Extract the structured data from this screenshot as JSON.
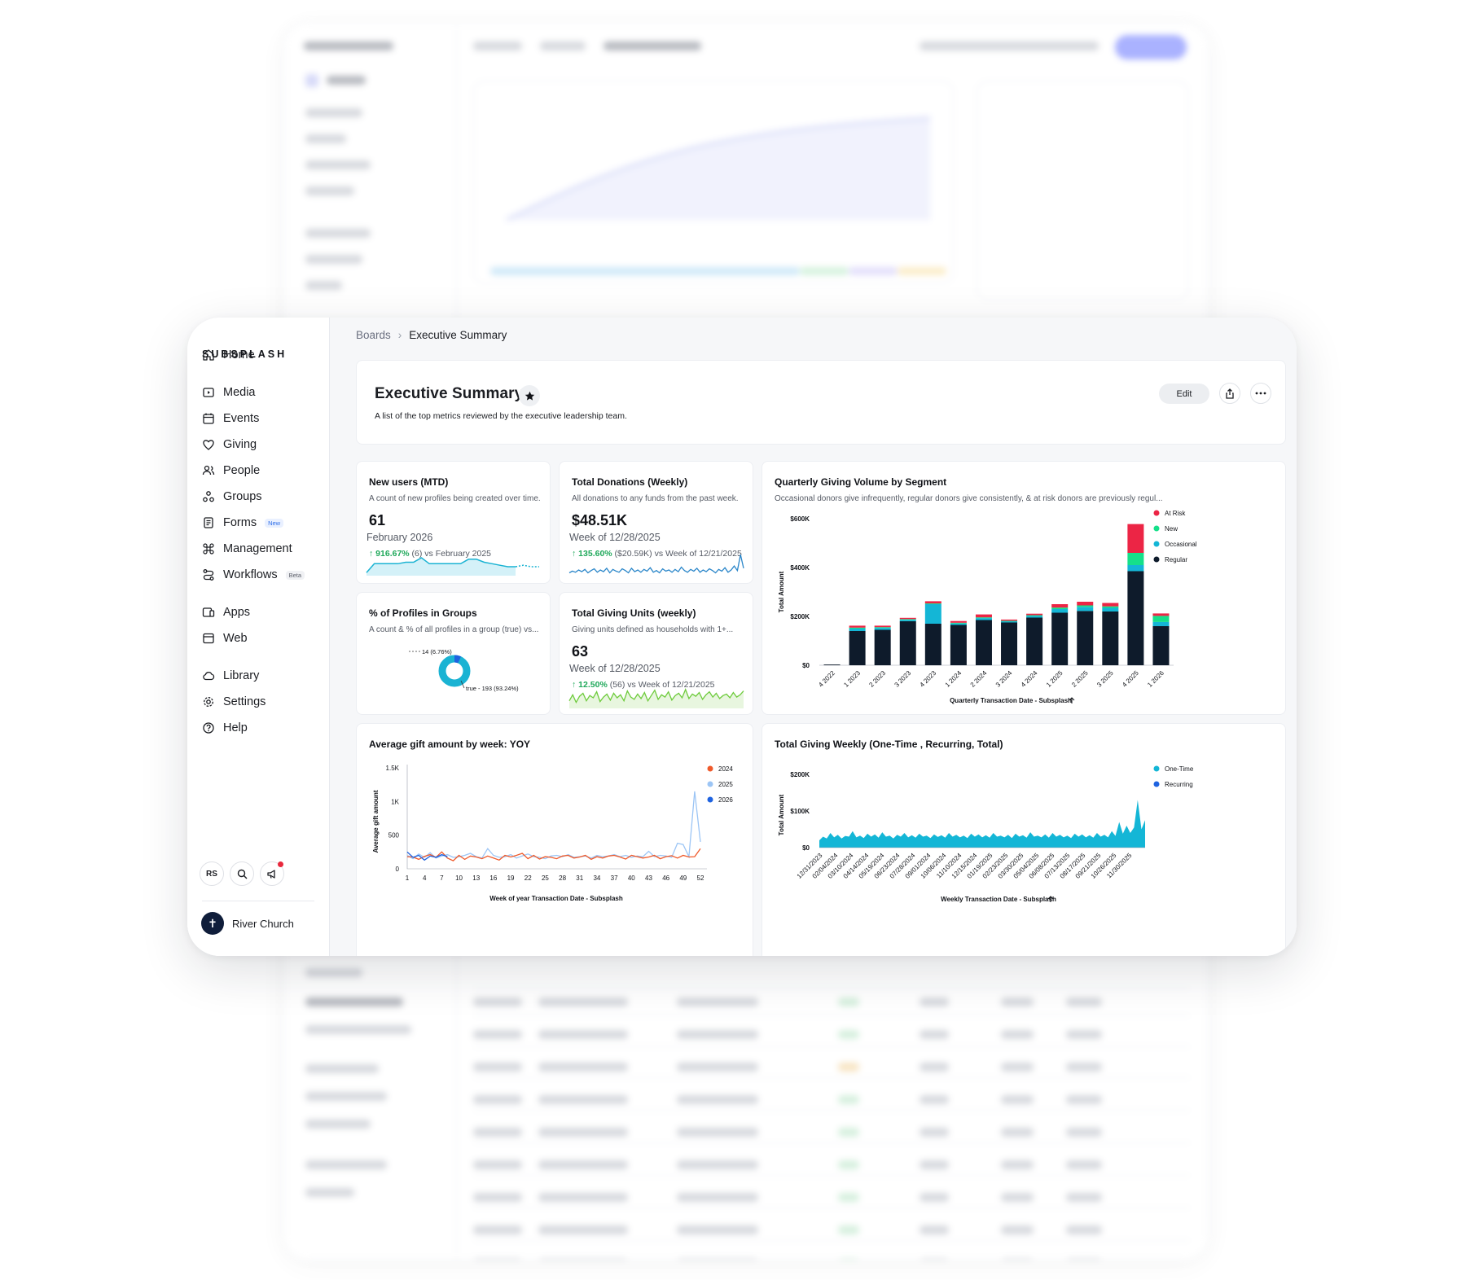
{
  "sidebar": {
    "logo": "SUBSPLASH",
    "items": [
      {
        "label": "Home"
      },
      {
        "label": "Media"
      },
      {
        "label": "Events"
      },
      {
        "label": "Giving"
      },
      {
        "label": "People"
      },
      {
        "label": "Groups"
      },
      {
        "label": "Forms",
        "badge": "New"
      },
      {
        "label": "Management"
      },
      {
        "label": "Workflows",
        "badge": "Beta"
      },
      {
        "label": "Apps"
      },
      {
        "label": "Web"
      },
      {
        "label": "Library"
      },
      {
        "label": "Settings"
      },
      {
        "label": "Help"
      }
    ],
    "user_initials": "RS",
    "org_name": "River Church"
  },
  "breadcrumb": {
    "parent": "Boards",
    "current": "Executive Summary"
  },
  "header": {
    "title": "Executive Summary",
    "description": "A list of the top metrics reviewed by the executive leadership team.",
    "edit_label": "Edit"
  },
  "cards": {
    "new_users": {
      "title": "New users (MTD)",
      "description": "A count of new profiles being created over time.",
      "value": "61",
      "period": "February 2026",
      "change_pct": "916.67%",
      "change_detail": "(6) vs February 2025"
    },
    "donations": {
      "title": "Total Donations (Weekly)",
      "description": "All donations to any funds from the past week.",
      "value": "$48.51K",
      "period": "Week of 12/28/2025",
      "change_pct": "135.60%",
      "change_detail": "($20.59K) vs Week of 12/21/2025"
    },
    "profiles_groups": {
      "title": "% of Profiles in Groups",
      "description": "A count & % of all profiles in a group (true) vs...",
      "label_false": "14 (6.76%)",
      "label_true": "true - 193 (93.24%)"
    },
    "giving_units": {
      "title": "Total Giving Units (weekly)",
      "description": "Giving units defined as households with 1+...",
      "value": "63",
      "period": "Week of 12/28/2025",
      "change_pct": "12.50%",
      "change_detail": "(56) vs Week of 12/21/2025"
    },
    "quarterly": {
      "title": "Quarterly Giving Volume by Segment",
      "description": "Occasional donors give infrequently, regular donors give consistently, & at risk donors are previously regul..."
    },
    "avg_gift": {
      "title": "Average gift amount by week: YOY"
    },
    "giving_weekly": {
      "title": "Total Giving Weekly (One-Time , Recurring, Total)"
    }
  },
  "colors": {
    "teal": "#1ab3d3",
    "teal_fill": "#d4f1f8",
    "regular": "#0e1b2b",
    "occasional": "#14b6d6",
    "new": "#15e08a",
    "at_risk": "#ec2545",
    "y2024": "#ef5a2b",
    "y2025": "#9cc5f5",
    "y2026": "#1f63e0",
    "green": "#6ecb3c",
    "up": "#1fa85a"
  },
  "chart_data": [
    {
      "type": "pie",
      "title": "% of Profiles in Groups",
      "categories": [
        "false",
        "true"
      ],
      "values": [
        14,
        193
      ],
      "labels": [
        "14 (6.76%)",
        "true - 193 (93.24%)"
      ]
    },
    {
      "type": "bar",
      "title": "Quarterly Giving Volume by Segment",
      "xlabel": "Quarterly Transaction Date - Subsplash",
      "ylabel": "Total Amount",
      "ylim": [
        0,
        600000
      ],
      "yticks": [
        "$0",
        "$200K",
        "$400K",
        "$600K"
      ],
      "legend_position": "top-right",
      "categories": [
        "4 2022",
        "1 2023",
        "2 2023",
        "3 2023",
        "4 2023",
        "1 2024",
        "2 2024",
        "3 2024",
        "4 2024",
        "1 2025",
        "2 2025",
        "3 2025",
        "4 2025",
        "1 2026"
      ],
      "series": [
        {
          "name": "Regular",
          "values": [
            3000,
            140000,
            145000,
            180000,
            170000,
            165000,
            185000,
            175000,
            195000,
            215000,
            222000,
            220000,
            385000,
            160000
          ]
        },
        {
          "name": "Occasional",
          "values": [
            0,
            10000,
            8000,
            6000,
            80000,
            6000,
            8000,
            5000,
            7000,
            15000,
            17000,
            15000,
            25000,
            17000
          ]
        },
        {
          "name": "New",
          "values": [
            0,
            4000,
            3000,
            3000,
            3000,
            3000,
            3000,
            2000,
            3000,
            6000,
            6000,
            6000,
            50000,
            25000
          ]
        },
        {
          "name": "At Risk",
          "values": [
            0,
            8000,
            6000,
            5000,
            9000,
            7000,
            12000,
            5000,
            6000,
            14000,
            15000,
            14000,
            118000,
            10000
          ]
        }
      ]
    },
    {
      "type": "line",
      "title": "Average gift amount by week: YOY",
      "xlabel": "Week of year Transaction Date - Subsplash",
      "ylabel": "Average gift amount",
      "ylim": [
        0,
        1500
      ],
      "yticks": [
        "0",
        "500",
        "1K",
        "1.5K"
      ],
      "xticks": [
        "1",
        "4",
        "7",
        "10",
        "13",
        "16",
        "19",
        "22",
        "25",
        "28",
        "31",
        "34",
        "37",
        "40",
        "43",
        "46",
        "49",
        "52"
      ],
      "legend_position": "top-right",
      "series": [
        {
          "name": "2024",
          "values": [
            180,
            175,
            140,
            185,
            210,
            170,
            250,
            160,
            120,
            200,
            140,
            190,
            175,
            150,
            190,
            160,
            130,
            200,
            175,
            200,
            230,
            150,
            200,
            145,
            180,
            170,
            150,
            190,
            200,
            160,
            175,
            200,
            140,
            180,
            160,
            190,
            200,
            175,
            145,
            200,
            180,
            160,
            175,
            200,
            150,
            180,
            195,
            160,
            200,
            175,
            180,
            300
          ]
        },
        {
          "name": "2025",
          "values": [
            200,
            150,
            220,
            170,
            240,
            160,
            190,
            210,
            170,
            180,
            200,
            230,
            180,
            160,
            300,
            200,
            170,
            180,
            210,
            160,
            190,
            220,
            180,
            170,
            150,
            190,
            200,
            180,
            210,
            170,
            180,
            190,
            160,
            200,
            180,
            190,
            210,
            180,
            200,
            170,
            190,
            180,
            260,
            180,
            200,
            190,
            170,
            380,
            360,
            180,
            1150,
            400
          ]
        },
        {
          "name": "2026",
          "values": [
            250,
            170,
            200,
            130,
            190,
            170,
            210,
            180
          ]
        }
      ]
    },
    {
      "type": "area",
      "title": "Total Giving Weekly (One-Time , Recurring, Total)",
      "xlabel": "Weekly Transaction Date - Subsplash",
      "ylabel": "Total Amount",
      "ylim": [
        0,
        200000
      ],
      "yticks": [
        "$0",
        "$100K",
        "$200K"
      ],
      "xticks": [
        "12/31/2023",
        "02/04/2024",
        "03/10/2024",
        "04/14/2024",
        "05/19/2024",
        "06/23/2024",
        "07/28/2024",
        "09/01/2024",
        "10/06/2024",
        "11/10/2024",
        "12/15/2024",
        "01/19/2025",
        "02/23/2025",
        "03/30/2025",
        "05/04/2025",
        "06/08/2025",
        "07/13/2025",
        "08/17/2025",
        "09/21/2025",
        "10/26/2025",
        "11/30/2025"
      ],
      "legend_position": "top-right",
      "series": [
        {
          "name": "One-Time",
          "values": [
            20000,
            30000,
            25000,
            40000,
            28000,
            35000,
            25000,
            32000,
            30000,
            45000,
            28000,
            33000,
            26000,
            38000,
            30000,
            36000,
            27000,
            42000,
            30000,
            33000,
            25000,
            35000,
            30000,
            40000,
            28000,
            34000,
            27000,
            38000,
            30000,
            33000,
            26000,
            36000,
            29000,
            34000,
            27000,
            40000,
            30000,
            35000,
            28000,
            33000,
            26000,
            38000,
            30000,
            36000,
            28000,
            34000,
            27000,
            40000,
            30000,
            33000,
            28000,
            35000,
            26000,
            38000,
            30000,
            34000,
            27000,
            42000,
            30000,
            33000,
            28000,
            36000,
            27000,
            40000,
            30000,
            35000,
            28000,
            33000,
            26000,
            38000,
            30000,
            36000,
            28000,
            34000,
            27000,
            40000,
            30000,
            35000,
            28000,
            45000,
            32000,
            70000,
            38000,
            60000,
            40000,
            55000,
            130000,
            50000,
            75000
          ]
        }
      ]
    },
    {
      "type": "area",
      "title": "New users (MTD)",
      "values": [
        2,
        8,
        8,
        8,
        8,
        9,
        9,
        12,
        8,
        8,
        8,
        8,
        8,
        11,
        11,
        9,
        8,
        7,
        6,
        6,
        7,
        6,
        6
      ]
    },
    {
      "type": "line",
      "title": "Total Donations (Weekly)",
      "values": [
        30,
        33,
        31,
        35,
        32,
        36,
        30,
        34,
        37,
        31,
        35,
        32,
        38,
        30,
        36,
        33,
        31,
        37,
        34,
        30,
        38,
        32,
        35,
        31,
        36,
        33,
        39,
        31,
        34,
        30,
        37,
        33,
        35,
        31,
        36,
        32,
        40,
        34,
        31,
        36,
        33,
        38,
        31,
        35,
        32,
        37,
        34,
        30,
        36,
        33,
        39,
        31,
        35,
        42,
        34,
        62,
        38
      ]
    },
    {
      "type": "area",
      "title": "Total Giving Units (weekly)",
      "values": [
        50,
        58,
        48,
        56,
        60,
        50,
        57,
        54,
        62,
        49,
        55,
        59,
        51,
        60,
        54,
        58,
        50,
        63,
        55,
        52,
        59,
        53,
        61,
        50,
        57,
        64,
        52,
        58,
        55,
        62,
        51,
        57,
        60,
        54,
        65,
        53,
        59,
        56,
        61,
        52,
        58,
        62,
        55,
        60,
        53,
        57,
        59,
        54,
        61,
        55,
        58,
        63
      ]
    }
  ]
}
